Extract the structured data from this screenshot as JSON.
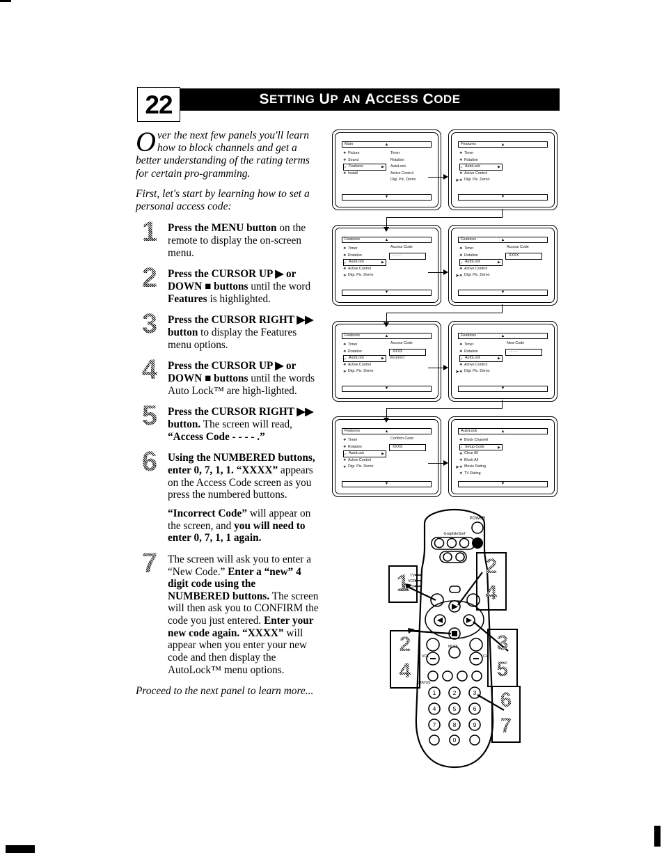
{
  "page": {
    "number": "22",
    "header_title": "SETTING UP AN ACCESS CODE",
    "header_words": [
      "S",
      "ETTING",
      "U",
      "P",
      "AN",
      "A",
      "CCESS",
      "C",
      "ODE"
    ]
  },
  "intro": {
    "dropcap": "O",
    "paragraph1": "ver the next few panels you'll learn how to block channels and get a better understanding of the rating terms for certain pro-gramming.",
    "paragraph2": "First, let's start by learning how to set a personal access code:"
  },
  "steps": [
    {
      "number": "1",
      "html": "<b>Press the MENU button</b> on the remote to display the on-screen menu."
    },
    {
      "number": "2",
      "html": "<b>Press the CURSOR UP ▶ or DOWN ■ buttons</b> until the word <b>Features</b> is highlighted."
    },
    {
      "number": "3",
      "html": "<b>Press the CURSOR RIGHT ▶▶ button</b> to display the Features menu options."
    },
    {
      "number": "4",
      "html": "<b>Press the CURSOR UP ▶ or DOWN ■ buttons</b> until the words Auto Lock™ are high-lighted."
    },
    {
      "number": "5",
      "html": "<b>Press the CURSOR RIGHT ▶▶ button.</b> The screen will read, <b>“Access Code - - - - .”</b>"
    },
    {
      "number": "6",
      "html": "<b>Using the NUMBERED buttons, enter 0, 7, 1, 1. “XXXX”</b> appears on the Access Code screen as you press the numbered buttons."
    },
    {
      "number": "7",
      "html": "The screen will ask you to enter a “New Code.” <b>Enter a “new” 4 digit code using the NUMBERED buttons.</b> The screen will then ask you to CONFIRM the code you just entered. <b>Enter your new code again.</b> <b>“XXXX”</b> will appear when you enter your new code and then display the AutoLock™ menu options."
    }
  ],
  "note": {
    "html": "<b>“Incorrect Code”</b> will appear on the screen, and <b>you will need to enter 0, 7, 1, 1 again.</b>"
  },
  "outro": "Proceed to the next panel to learn more...",
  "screens": [
    {
      "id": "main-menu",
      "title": "Main",
      "items": [
        {
          "label": "Picture",
          "bullet": "❖",
          "highlighted": false
        },
        {
          "label": "Sound",
          "bullet": "❖",
          "highlighted": false
        },
        {
          "label": "Features",
          "bullet": "✓",
          "highlighted": true
        },
        {
          "label": "Install",
          "bullet": "❖",
          "highlighted": false
        }
      ],
      "right_items": [
        "Timer",
        "Rotation",
        "AutoLock",
        "Active Control",
        "Digi. Pic. Demo"
      ],
      "field_label": "",
      "field_value": "",
      "status": "",
      "pointer_row": -1
    },
    {
      "id": "features-menu",
      "title": "Features",
      "items": [
        {
          "label": "Timer",
          "bullet": "❖",
          "highlighted": false
        },
        {
          "label": "Rotation",
          "bullet": "❖",
          "highlighted": false
        },
        {
          "label": "AutoLock",
          "bullet": "✓",
          "highlighted": true
        },
        {
          "label": "Active Control",
          "bullet": "❖",
          "highlighted": false
        },
        {
          "label": "Digi. Pic. Demo",
          "bullet": "❖",
          "highlighted": false
        }
      ],
      "right_items": [],
      "field_label": "",
      "field_value": "",
      "status": "",
      "pointer_row": 4
    },
    {
      "id": "access-code-empty",
      "title": "Features",
      "items": [
        {
          "label": "Timer",
          "bullet": "❖",
          "highlighted": false
        },
        {
          "label": "Rotation",
          "bullet": "❖",
          "highlighted": false
        },
        {
          "label": "AutoLock",
          "bullet": "✓",
          "highlighted": true
        },
        {
          "label": "Active Control",
          "bullet": "❖",
          "highlighted": false
        },
        {
          "label": "Digi. Pic. Demo",
          "bullet": "❖",
          "highlighted": false
        }
      ],
      "right_items": [],
      "field_label": "Access Code",
      "field_value": "- - - -",
      "status": "",
      "pointer_row": -1
    },
    {
      "id": "access-code-entered",
      "title": "Features",
      "items": [
        {
          "label": "Timer",
          "bullet": "❖",
          "highlighted": false
        },
        {
          "label": "Rotation",
          "bullet": "❖",
          "highlighted": false
        },
        {
          "label": "AutoLock",
          "bullet": "✓",
          "highlighted": true
        },
        {
          "label": "Active Control",
          "bullet": "❖",
          "highlighted": false
        },
        {
          "label": "Digi. Pic. Demo",
          "bullet": "❖",
          "highlighted": false
        }
      ],
      "right_items": [],
      "field_label": "Access Code",
      "field_value": "XXXX",
      "status": "",
      "pointer_row": 4
    },
    {
      "id": "access-code-incorrect",
      "title": "Features",
      "items": [
        {
          "label": "Timer",
          "bullet": "❖",
          "highlighted": false
        },
        {
          "label": "Rotation",
          "bullet": "❖",
          "highlighted": false
        },
        {
          "label": "AutoLock",
          "bullet": "✓",
          "highlighted": true
        },
        {
          "label": "Active Control",
          "bullet": "❖",
          "highlighted": false
        },
        {
          "label": "Digi. Pic. Demo",
          "bullet": "❖",
          "highlighted": false
        }
      ],
      "right_items": [],
      "field_label": "Access Code",
      "field_value": "XXXX",
      "status": "Incorrect",
      "pointer_row": -1
    },
    {
      "id": "new-code",
      "title": "Features",
      "items": [
        {
          "label": "Timer",
          "bullet": "❖",
          "highlighted": false
        },
        {
          "label": "Rotation",
          "bullet": "❖",
          "highlighted": false
        },
        {
          "label": "AutoLock",
          "bullet": "✓",
          "highlighted": true
        },
        {
          "label": "Active Control",
          "bullet": "❖",
          "highlighted": false
        },
        {
          "label": "Digi. Pic. Demo",
          "bullet": "❖",
          "highlighted": false
        }
      ],
      "right_items": [],
      "field_label": "New Code",
      "field_value": "- - - -",
      "status": "",
      "pointer_row": 4
    },
    {
      "id": "confirm-code",
      "title": "Features",
      "items": [
        {
          "label": "Timer",
          "bullet": "❖",
          "highlighted": false
        },
        {
          "label": "Rotation",
          "bullet": "❖",
          "highlighted": false
        },
        {
          "label": "AutoLock",
          "bullet": "✓",
          "highlighted": true
        },
        {
          "label": "Active Control",
          "bullet": "❖",
          "highlighted": false
        },
        {
          "label": "Digi. Pic. Demo",
          "bullet": "❖",
          "highlighted": false
        }
      ],
      "right_items": [],
      "field_label": "Confirm Code",
      "field_value": "XXXX",
      "status": "",
      "pointer_row": -1
    },
    {
      "id": "autolock-menu",
      "title": "AutoLock",
      "items": [
        {
          "label": "Block Channel",
          "bullet": "❖",
          "highlighted": false
        },
        {
          "label": "Setup Code",
          "bullet": "✓",
          "highlighted": true
        },
        {
          "label": "Clear All",
          "bullet": "❖",
          "highlighted": false
        },
        {
          "label": "Block All",
          "bullet": "❖",
          "highlighted": false
        },
        {
          "label": "Movie Rating",
          "bullet": "❖",
          "highlighted": false
        },
        {
          "label": "TV Rating",
          "bullet": "❖",
          "highlighted": false
        }
      ],
      "right_items": [],
      "field_label": "",
      "field_value": "",
      "status": "",
      "pointer_row": 4
    }
  ],
  "remote": {
    "power_label": "POWER",
    "brand_label": "GraphiteSurf",
    "mode_labels": [
      "TV",
      "VCR",
      "AUX"
    ],
    "volume_label": "VOL",
    "channel_label": "CH",
    "mute_label": "MUTE",
    "status_label": "STATUS",
    "keypad": [
      "1",
      "2",
      "3",
      "4",
      "5",
      "6",
      "7",
      "8",
      "9",
      "●",
      "0",
      "◉"
    ],
    "callouts": [
      {
        "id": "callout-1",
        "lines": [
          "1"
        ]
      },
      {
        "id": "callout-24",
        "lines": [
          "2",
          "4"
        ]
      },
      {
        "id": "callout-24b",
        "lines": [
          "2",
          "4"
        ]
      },
      {
        "id": "callout-35",
        "lines": [
          "3",
          "5"
        ]
      },
      {
        "id": "callout-67",
        "lines": [
          "6",
          "7"
        ]
      }
    ]
  }
}
